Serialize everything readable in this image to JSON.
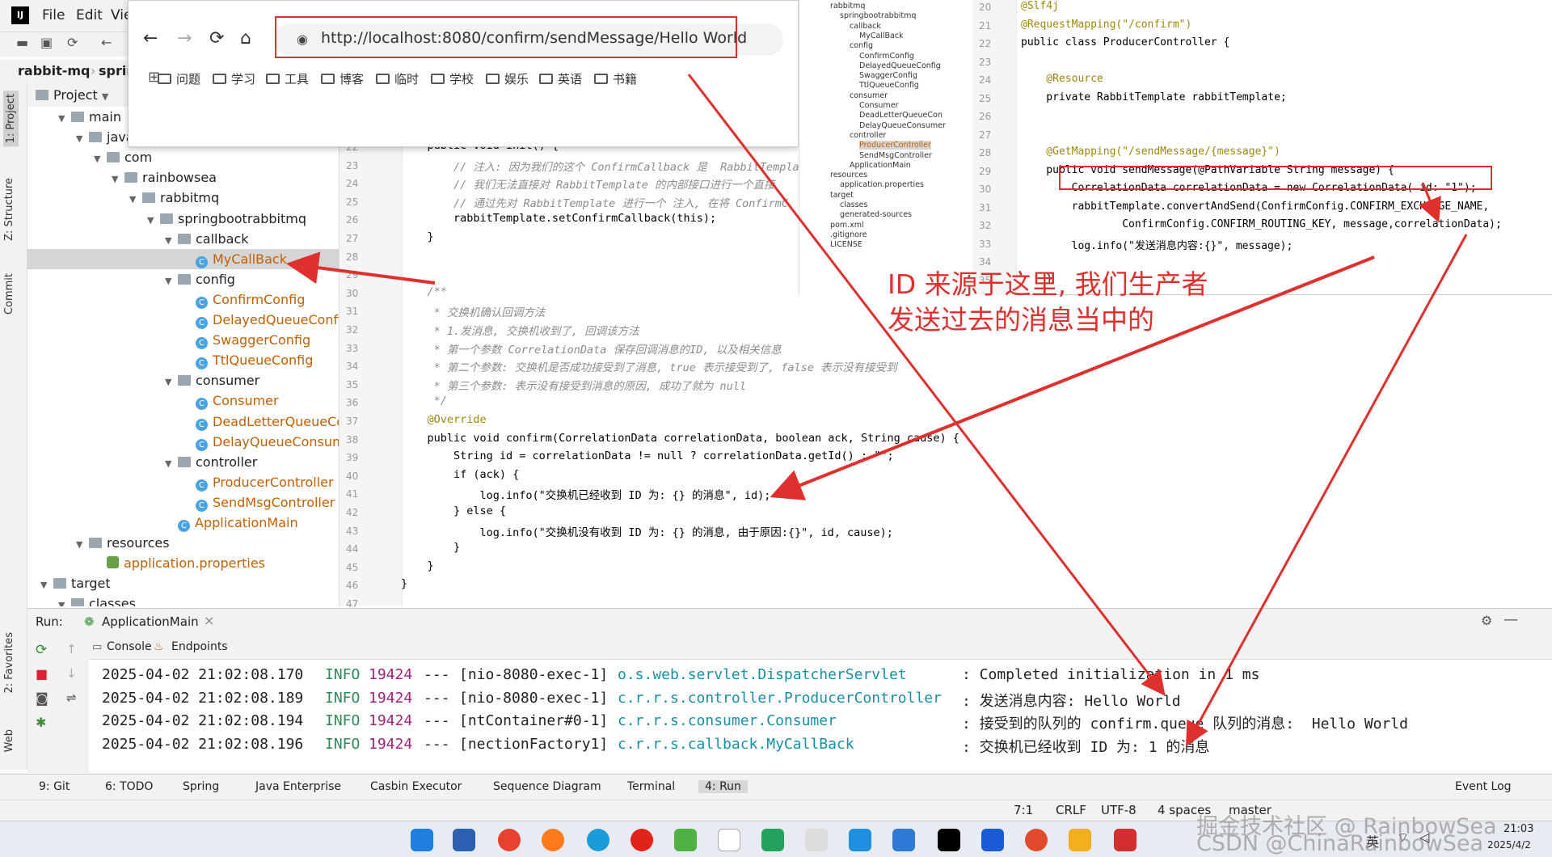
{
  "ide": {
    "menu": [
      "File",
      "Edit",
      "Vie"
    ],
    "nav_path": [
      "rabbit-mq",
      "sprin"
    ],
    "project_panel_title": "Project",
    "side_tabs": [
      "1: Project",
      "Z: Structure",
      "Commit",
      "2: Favorites",
      "Web"
    ]
  },
  "tree": [
    {
      "label": "main",
      "type": "folder",
      "depth": 1
    },
    {
      "label": "java",
      "type": "folder",
      "depth": 2
    },
    {
      "label": "com",
      "type": "folder",
      "depth": 3
    },
    {
      "label": "rainbowsea",
      "type": "folder",
      "depth": 4
    },
    {
      "label": "rabbitmq",
      "type": "folder",
      "depth": 5
    },
    {
      "label": "springbootrabbitmq",
      "type": "folder",
      "depth": 6
    },
    {
      "label": "callback",
      "type": "folder",
      "depth": 7
    },
    {
      "label": "MyCallBack",
      "type": "class",
      "depth": 8,
      "selected": true
    },
    {
      "label": "config",
      "type": "folder",
      "depth": 7
    },
    {
      "label": "ConfirmConfig",
      "type": "class",
      "depth": 8
    },
    {
      "label": "DelayedQueueConfig",
      "type": "class",
      "depth": 8
    },
    {
      "label": "SwaggerConfig",
      "type": "class",
      "depth": 8
    },
    {
      "label": "TtlQueueConfig",
      "type": "class",
      "depth": 8
    },
    {
      "label": "consumer",
      "type": "folder",
      "depth": 7
    },
    {
      "label": "Consumer",
      "type": "class",
      "depth": 8
    },
    {
      "label": "DeadLetterQueueCon",
      "type": "class",
      "depth": 8
    },
    {
      "label": "DelayQueueConsumer",
      "type": "class",
      "depth": 8
    },
    {
      "label": "controller",
      "type": "folder",
      "depth": 7
    },
    {
      "label": "ProducerController",
      "type": "class",
      "depth": 8
    },
    {
      "label": "SendMsgController",
      "type": "class",
      "depth": 8
    },
    {
      "label": "ApplicationMain",
      "type": "class",
      "depth": 7
    },
    {
      "label": "resources",
      "type": "folder",
      "depth": 2
    },
    {
      "label": "application.properties",
      "type": "prop",
      "depth": 3
    },
    {
      "label": "target",
      "type": "folder",
      "depth": 0
    },
    {
      "label": "classes",
      "type": "folder",
      "depth": 1
    }
  ],
  "browser": {
    "url": "http://localhost:8080/confirm/sendMessage/Hello World",
    "bookmarks": [
      "问题",
      "学习",
      "工具",
      "博客",
      "临时",
      "学校",
      "娱乐",
      "英语",
      "书籍"
    ]
  },
  "editor": {
    "line_numbers": [
      "22",
      "23",
      "24",
      "25",
      "26",
      "27",
      "28",
      "29",
      "30",
      "31",
      "32",
      "33",
      "34",
      "35",
      "36",
      "37",
      "38",
      "39",
      "40",
      "41",
      "42",
      "43",
      "44",
      "45",
      "46",
      "47"
    ],
    "lines": [
      "    public void init() {",
      "        // 注入: 因为我们的这个 ConfirmCallback 是  RabbitTemplate",
      "        // 我们无法直接对 RabbitTemplate 的内部接口进行一个直接",
      "        // 通过先对 RabbitTemplate 进行一个 注入, 在将 ConfirmC",
      "        rabbitTemplate.setConfirmCallback(this);",
      "    }",
      "",
      "",
      "    /**",
      "     * 交换机确认回调方法",
      "     * 1.发消息, 交换机收到了, 回调该方法",
      "     * 第一个参数 CorrelationData 保存回调消息的ID, 以及相关信息",
      "     * 第二个参数: 交换机是否成功接受到了消息, true 表示接受到了, false 表示没有接受到",
      "     * 第三个参数: 表示没有接受到消息的原因, 成功了就为 null",
      "     */",
      "    @Override",
      "    public void confirm(CorrelationData correlationData, boolean ack, String cause) {",
      "        String id = correlationData != null ? correlationData.getId() : \"\";",
      "        if (ack) {",
      "            log.info(\"交换机已经收到 ID 为: {} 的消息\", id);",
      "        } else {",
      "            log.info(\"交换机没有收到 ID 为: {} 的消息, 由于原因:{}\", id, cause);",
      "        }",
      "    }",
      "}",
      ""
    ]
  },
  "mini_tree": [
    "rabbitmq",
    "springbootrabbitmq",
    "callback",
    "MyCallBack",
    "config",
    "ConfirmConfig",
    "DelayedQueueConfig",
    "SwaggerConfig",
    "TtlQueueConfig",
    "consumer",
    "Consumer",
    "DeadLetterQueueCon",
    "DelayQueueConsumer",
    "controller",
    "ProducerController",
    "SendMsgController",
    "ApplicationMain",
    "resources",
    "application.properties",
    "target",
    "classes",
    "generated-sources",
    "pom.xml",
    ".gitignore",
    "LICENSE"
  ],
  "mini_code": {
    "line_numbers": [
      "20",
      "21",
      "22",
      "23",
      "24",
      "25",
      "26",
      "27",
      "28",
      "29",
      "30",
      "31",
      "32",
      "33",
      "34",
      "35"
    ],
    "lines": [
      "@Slf4j",
      "@RequestMapping(\"/confirm\")",
      "public class ProducerController {",
      "",
      "    @Resource",
      "    private RabbitTemplate rabbitTemplate;",
      "",
      "",
      "    @GetMapping(\"/sendMessage/{message}\")",
      "    public void sendMessage(@PathVariable String message) {",
      "        CorrelationData correlationData = new CorrelationData( id: \"1\");",
      "        rabbitTemplate.convertAndSend(ConfirmConfig.CONFIRM_EXCHANGE_NAME,",
      "                ConfirmConfig.CONFIRM_ROUTING_KEY, message,correlationData);",
      "        log.info(\"发送消息内容:{}\", message);",
      "",
      "    }"
    ]
  },
  "annotation": [
    "ID 来源于这里, 我们生产者",
    "发送过去的消息当中的"
  ],
  "run": {
    "label": "Run:",
    "config": "ApplicationMain",
    "tabs": [
      "Console",
      "Endpoints"
    ],
    "logs": [
      {
        "ts": "2025-04-02 21:02:08.170",
        "level": "INFO",
        "pid": "19424",
        "sep": "---",
        "thread": "[nio-8080-exec-1]",
        "cls": "o.s.web.servlet.DispatcherServlet",
        "msg": ": Completed initialization in 1 ms"
      },
      {
        "ts": "2025-04-02 21:02:08.189",
        "level": "INFO",
        "pid": "19424",
        "sep": "---",
        "thread": "[nio-8080-exec-1]",
        "cls": "c.r.r.s.controller.ProducerController",
        "msg": ": 发送消息内容: Hello World"
      },
      {
        "ts": "2025-04-02 21:02:08.194",
        "level": "INFO",
        "pid": "19424",
        "sep": "---",
        "thread": "[ntContainer#0-1]",
        "cls": "c.r.r.s.consumer.Consumer",
        "msg": ": 接受到的队列的 confirm.queue 队列的消息:  Hello World"
      },
      {
        "ts": "2025-04-02 21:02:08.196",
        "level": "INFO",
        "pid": "19424",
        "sep": "---",
        "thread": "[nectionFactory1]",
        "cls": "c.r.r.s.callback.MyCallBack",
        "msg": ": 交换机已经收到 ID 为: 1 的消息"
      }
    ]
  },
  "bottom_tabs": [
    "9: Git",
    "6: TODO",
    "Spring",
    "Java Enterprise",
    "Casbin Executor",
    "Sequence Diagram",
    "Terminal",
    "4: Run",
    "Event Log"
  ],
  "status": [
    "7:1",
    "CRLF",
    "UTF-8",
    "4 spaces",
    "master"
  ],
  "clock": {
    "time": "21:03",
    "date": "2025/4/2"
  },
  "tray": [
    "英"
  ],
  "watermark": "掘金技术社区 @ RainbowSea",
  "watermark2": "CSDN @ChinaRainbowSea",
  "colors": {
    "accent": "#e0302d",
    "info": "#2e8b57",
    "pid": "#a0237a",
    "logger": "#1a8fa3"
  }
}
